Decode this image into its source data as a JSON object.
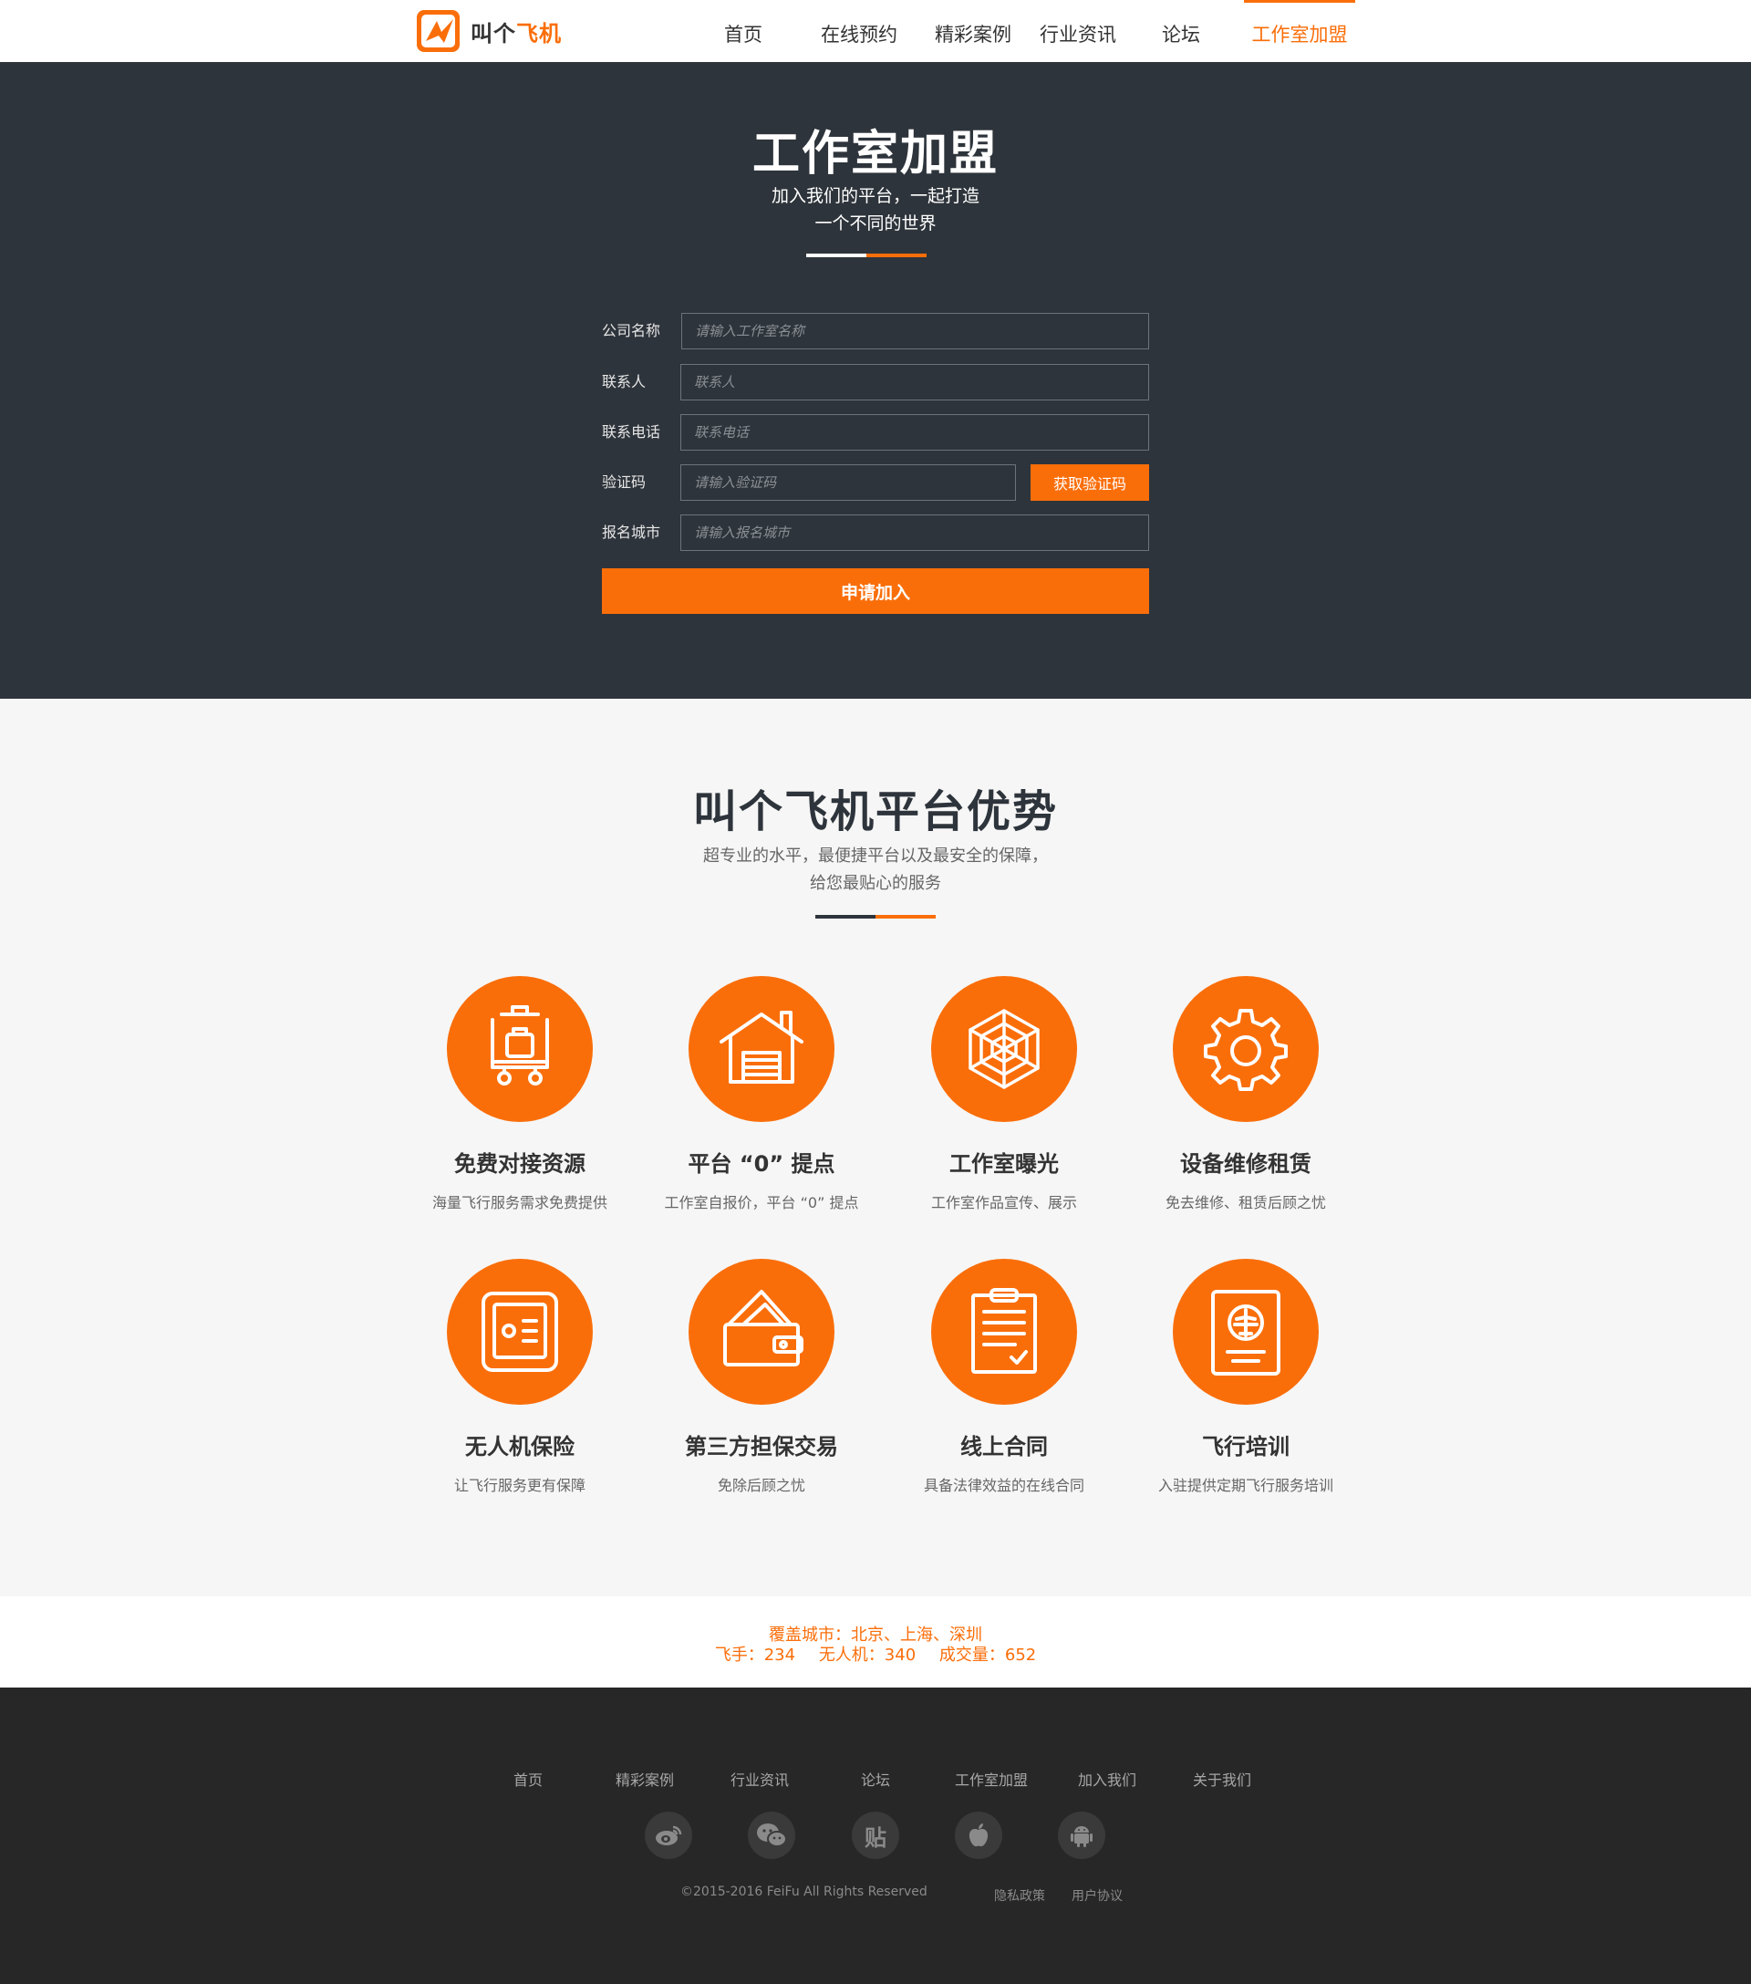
{
  "brand": {
    "name_part1": "叫个",
    "name_part2": "飞机",
    "accent": "#fa6e0a",
    "dark": "#2e343b"
  },
  "nav": {
    "items": [
      {
        "label": "首页"
      },
      {
        "label": "在线预约"
      },
      {
        "label": "精彩案例"
      },
      {
        "label": "行业资讯"
      },
      {
        "label": "论坛"
      },
      {
        "label": "工作室加盟"
      }
    ],
    "active": "工作室加盟"
  },
  "hero": {
    "title": "工作室加盟",
    "sub1": "加入我们的平台，一起打造",
    "sub2": "一个不同的世界"
  },
  "form": {
    "company": {
      "label": "公司名称",
      "placeholder": "请输入工作室名称"
    },
    "contact": {
      "label": "联系人",
      "placeholder": "联系人"
    },
    "phone": {
      "label": "联系电话",
      "placeholder": "联系电话"
    },
    "code": {
      "label": "验证码",
      "placeholder": "请输入验证码",
      "button": "获取验证码"
    },
    "city": {
      "label": "报名城市",
      "placeholder": "请输入报名城市"
    },
    "submit": "申请加入"
  },
  "advantages": {
    "title": "叫个飞机平台优势",
    "sub1": "超专业的水平，最便捷平台以及最安全的保障，",
    "sub2": "给您最贴心的服务",
    "items": [
      {
        "title": "免费对接资源",
        "desc": "海量飞行服务需求免费提供",
        "icon": "luggage-cart-icon"
      },
      {
        "title": "平台 “0” 提点",
        "desc": "工作室自报价，平台 “0” 提点",
        "icon": "garage-house-icon"
      },
      {
        "title": "工作室曝光",
        "desc": "工作室作品宣传、展示",
        "icon": "spider-web-icon"
      },
      {
        "title": "设备维修租赁",
        "desc": "免去维修、租赁后顾之忧",
        "icon": "gear-icon"
      },
      {
        "title": "无人机保险",
        "desc": "让飞行服务更有保障",
        "icon": "safe-icon"
      },
      {
        "title": "第三方担保交易",
        "desc": "免除后顾之忧",
        "icon": "wallet-icon"
      },
      {
        "title": "线上合同",
        "desc": "具备法律效益的在线合同",
        "icon": "clipboard-icon"
      },
      {
        "title": "飞行培训",
        "desc": "入驻提供定期飞行服务培训",
        "icon": "passport-icon"
      }
    ]
  },
  "stats": {
    "cities": "覆盖城市：北京、上海、深圳",
    "pilots": "飞手：234",
    "drones": "无人机：340",
    "deals": "成交量：652"
  },
  "footer": {
    "links": [
      {
        "label": "首页"
      },
      {
        "label": "精彩案例"
      },
      {
        "label": "行业资讯"
      },
      {
        "label": "论坛"
      },
      {
        "label": "工作室加盟"
      },
      {
        "label": "加入我们"
      },
      {
        "label": "关于我们"
      }
    ],
    "social": {
      "tieba": "贴"
    },
    "copyright": "©2015-2016 FeiFu All Rights Reserved",
    "privacy": "隐私政策",
    "terms": "用户协议"
  }
}
